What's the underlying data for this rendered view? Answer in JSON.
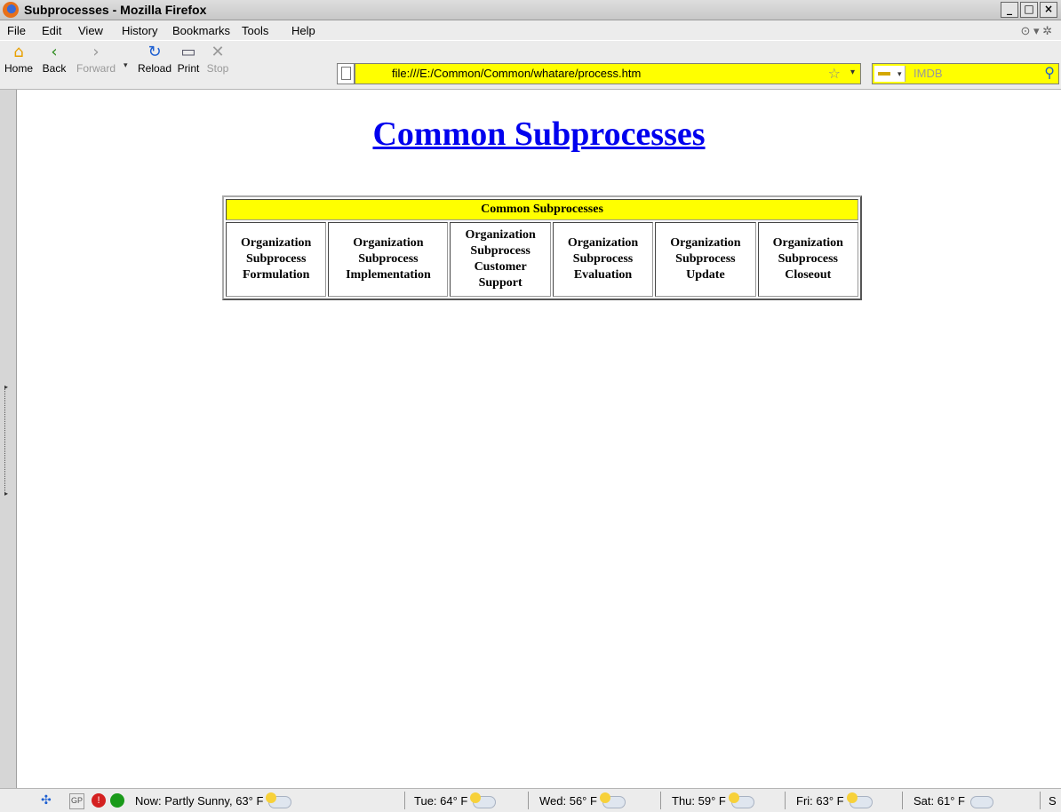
{
  "window": {
    "title": "Subprocesses - Mozilla Firefox"
  },
  "menu": [
    "File",
    "Edit",
    "View",
    "History",
    "Bookmarks",
    "Tools",
    "Help"
  ],
  "toolbar": {
    "home": "Home",
    "back": "Back",
    "forward": "Forward",
    "reload": "Reload",
    "print": "Print",
    "stop": "Stop"
  },
  "url": "file:///E:/Common/Common/whatare/process.htm",
  "search": {
    "placeholder": "IMDB"
  },
  "page": {
    "heading": "Common Subprocesses",
    "table": {
      "header": "Common Subprocesses",
      "cells": [
        [
          "Organization",
          "Subprocess",
          "Formulation"
        ],
        [
          "Organization",
          "Subprocess",
          "Implementation"
        ],
        [
          "Organization",
          "Subprocess",
          "Customer",
          "Support"
        ],
        [
          "Organization",
          "Subprocess",
          "Evaluation"
        ],
        [
          "Organization",
          "Subprocess",
          "Update"
        ],
        [
          "Organization",
          "Subprocess",
          "Closeout"
        ]
      ]
    }
  },
  "status": {
    "weather": [
      {
        "label": "Now: Partly Sunny, 63° F",
        "icon": "partly-sunny"
      },
      {
        "label": "Tue: 64° F",
        "icon": "partly-sunny"
      },
      {
        "label": "Wed: 56° F",
        "icon": "partly-sunny"
      },
      {
        "label": "Thu: 59° F",
        "icon": "partly-sunny"
      },
      {
        "label": "Fri: 63° F",
        "icon": "partly-sunny"
      },
      {
        "label": "Sat: 61° F",
        "icon": "cloudy"
      },
      {
        "label": "S",
        "icon": ""
      }
    ]
  },
  "colors": {
    "highlight": "#ffff00",
    "link": "#0000ee"
  }
}
